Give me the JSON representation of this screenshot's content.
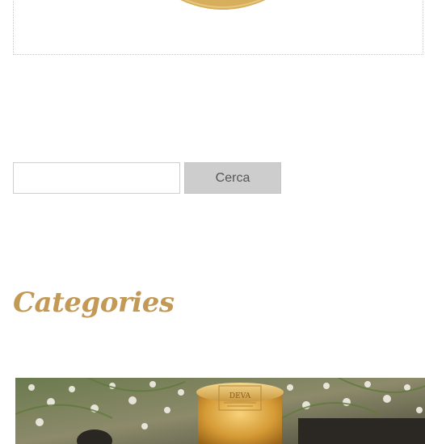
{
  "logo": {
    "icon": "gold-emblem-icon",
    "color": "#d7ae5c"
  },
  "search": {
    "value": "",
    "placeholder": "",
    "button_label": "Cerca"
  },
  "categories": {
    "title": "Categories",
    "title_color": "#c39a55",
    "featured_image": {
      "icon": "product-jar-photo",
      "lid_text": "DEVA"
    }
  }
}
